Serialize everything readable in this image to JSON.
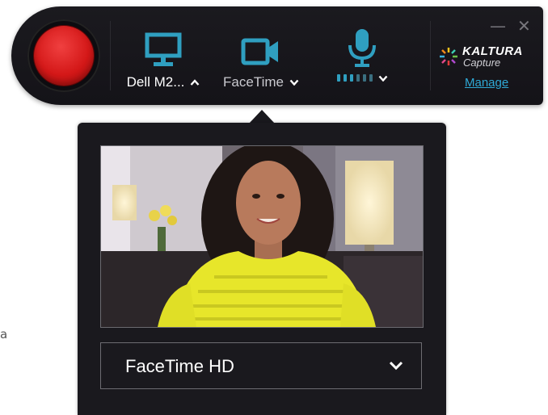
{
  "background": {
    "stray_letter": "a"
  },
  "toolbar": {
    "record_label": "Record",
    "screen": {
      "icon": "monitor-icon",
      "label": "Dell M2...",
      "chevron": "chevron-up-icon"
    },
    "camera": {
      "icon": "video-camera-icon",
      "label": "FaceTime",
      "chevron": "chevron-down-icon"
    },
    "audio": {
      "icon": "microphone-icon",
      "level": 0.5,
      "chevron": "chevron-down-icon"
    },
    "window_controls": {
      "minimize": "—",
      "close": "✕"
    },
    "brand": {
      "name": "KALTURA",
      "sub": "Capture"
    },
    "manage_link": "Manage"
  },
  "camera_popover": {
    "preview_icon": "webcam-preview-image",
    "selected_camera": "FaceTime HD",
    "chevron": "chevron-down-icon"
  },
  "colors": {
    "accent": "#2f9fc0",
    "record": "#d41818",
    "panel": "#1a191e",
    "link": "#2fa9d6"
  }
}
